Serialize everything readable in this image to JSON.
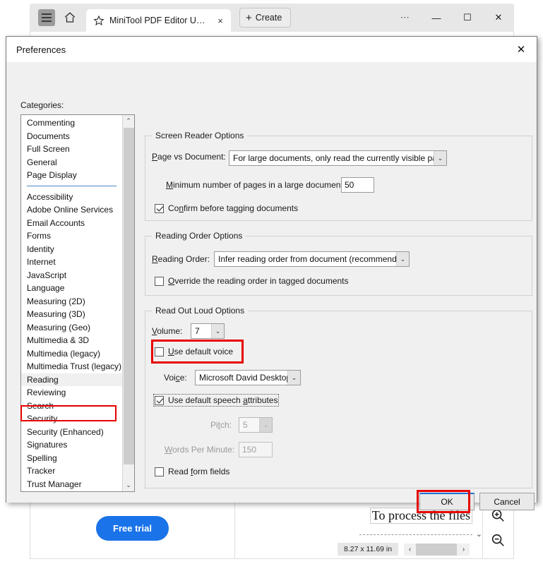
{
  "browser": {
    "menu_icon": "hamburger-icon",
    "home_icon": "home-icon",
    "tab": {
      "favicon": "star-icon",
      "title": "MiniTool PDF Editor Use…",
      "close_label": "×"
    },
    "create_button": {
      "plus": "+",
      "label": "Create"
    },
    "window_controls": {
      "more": "⋯",
      "minimize": "—",
      "maximize": "☐",
      "close": "✕"
    }
  },
  "page_behind": {
    "free_trial_label": "Free trial",
    "document_text": "To process the files",
    "page_size": "8.27 x 11.69 in",
    "scroll_left_arrow": "‹",
    "scroll_right_arrow": "›",
    "scroll_down_arrow": "⌄",
    "zoom_in_icon": "zoom-in-icon",
    "zoom_out_icon": "zoom-out-icon"
  },
  "dialog": {
    "title": "Preferences",
    "close_label": "✕",
    "categories_label": "Categories:",
    "categories_top": [
      "Commenting",
      "Documents",
      "Full Screen",
      "General",
      "Page Display"
    ],
    "categories_bottom": [
      "Accessibility",
      "Adobe Online Services",
      "Email Accounts",
      "Forms",
      "Identity",
      "Internet",
      "JavaScript",
      "Language",
      "Measuring (2D)",
      "Measuring (3D)",
      "Measuring (Geo)",
      "Multimedia & 3D",
      "Multimedia (legacy)",
      "Multimedia Trust (legacy)",
      "Reading",
      "Reviewing",
      "Search",
      "Security",
      "Security (Enhanced)",
      "Signatures",
      "Spelling",
      "Tracker",
      "Trust Manager"
    ],
    "selected_category": "Reading",
    "scroll_up_arrow": "⌃",
    "scroll_down_arrow": "⌄",
    "screen_reader": {
      "group_title": "Screen Reader Options",
      "page_vs_document_label": "Page vs Document:",
      "page_vs_document_value": "For large documents, only read the currently visible pages",
      "min_pages_label": "Minimum number of pages in a large document:",
      "min_pages_value": "50",
      "confirm_tagging_label": "Confirm before tagging documents",
      "confirm_tagging_checked": true
    },
    "reading_order": {
      "group_title": "Reading Order Options",
      "reading_order_label": "Reading Order:",
      "reading_order_value": "Infer reading order from document (recommended)",
      "override_label": "Override the reading order in tagged documents",
      "override_checked": false
    },
    "read_out_loud": {
      "group_title": "Read Out Loud Options",
      "volume_label": "Volume:",
      "volume_value": "7",
      "use_default_voice_label": "Use default voice",
      "use_default_voice_checked": false,
      "voice_label": "Voice:",
      "voice_value": "Microsoft David Desktop",
      "use_default_speech_label": "Use default speech attributes",
      "use_default_speech_checked": true,
      "pitch_label": "Pitch:",
      "pitch_value": "5",
      "wpm_label": "Words Per Minute:",
      "wpm_value": "150",
      "read_form_fields_label": "Read form fields",
      "read_form_fields_checked": false
    },
    "ok_label": "OK",
    "cancel_label": "Cancel",
    "combo_arrow": "⌄"
  },
  "highlight_color": "#e60000"
}
